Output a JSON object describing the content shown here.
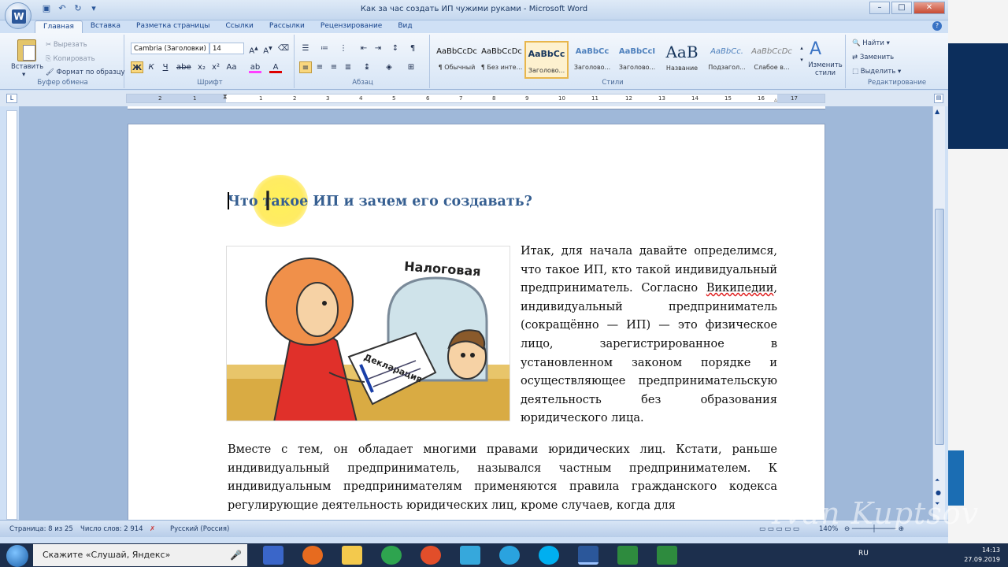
{
  "window": {
    "title": "Как за час создать ИП чужими руками - Microsoft Word"
  },
  "ribbon_tabs": [
    "Главная",
    "Вставка",
    "Разметка страницы",
    "Ссылки",
    "Рассылки",
    "Рецензирование",
    "Вид"
  ],
  "clipboard": {
    "paste": "Вставить",
    "cut": "Вырезать",
    "copy": "Копировать",
    "format_painter": "Формат по образцу",
    "label": "Буфер обмена"
  },
  "font": {
    "name": "Cambria (Заголовки)",
    "size": "14",
    "label": "Шрифт"
  },
  "paragraph": {
    "label": "Абзац"
  },
  "styles": {
    "label": "Стили",
    "items": [
      {
        "preview": "AaBbCcDc",
        "name": "¶ Обычный"
      },
      {
        "preview": "AaBbCcDc",
        "name": "¶ Без инте..."
      },
      {
        "preview": "AaBbCc",
        "name": "Заголово..."
      },
      {
        "preview": "AaBbCc",
        "name": "Заголово..."
      },
      {
        "preview": "AaBbCcI",
        "name": "Заголово..."
      },
      {
        "preview": "AaB",
        "name": "Название"
      },
      {
        "preview": "AaBbCc.",
        "name": "Подзагол..."
      },
      {
        "preview": "AaBbCcDc",
        "name": "Слабое в..."
      }
    ],
    "change": "Изменить стили"
  },
  "editing": {
    "find": "Найти",
    "replace": "Заменить",
    "select": "Выделить",
    "label": "Редактирование"
  },
  "ruler_numbers": [
    "2",
    "1",
    "1",
    "2",
    "3",
    "4",
    "5",
    "6",
    "7",
    "8",
    "9",
    "10",
    "11",
    "12",
    "13",
    "14",
    "15",
    "16",
    "17"
  ],
  "doc": {
    "heading": "Что такое ИП и зачем его создавать?",
    "illus_sign": "Налоговая",
    "illus_paper": "Декларация",
    "p1_before": "Итак, для начала давайте определимся, что такое ИП, кто такой индивидуальный предприниматель. Согласно ",
    "p1_link": "Википедии",
    "p1_after": ", индивидуальный предприниматель (сокращённо — ИП) — это физическое лицо, зарегистрированное в установленном законом порядке и осуществляющее предпринимательскую деятельность без образования юридического лица.",
    "p2": "Вместе с тем, он обладает многими правами юридических лиц. Кстати, раньше индивидуальный предприниматель, назывался частным предпринимателем. К индивидуальным предпринимателям применяются правила гражданского кодекса регулирующие деятельность юридических лиц, кроме случаев, когда для"
  },
  "status": {
    "page": "Страница: 8 из 25",
    "words": "Число слов: 2 914",
    "lang": "Русский (Россия)",
    "zoom": "140%"
  },
  "watermark": "Ivan Kuptsov",
  "taskbar": {
    "search": "Скажите «Слушай, Яндекс»",
    "lang": "RU",
    "time": "14:13",
    "date": "27.09.2019"
  }
}
